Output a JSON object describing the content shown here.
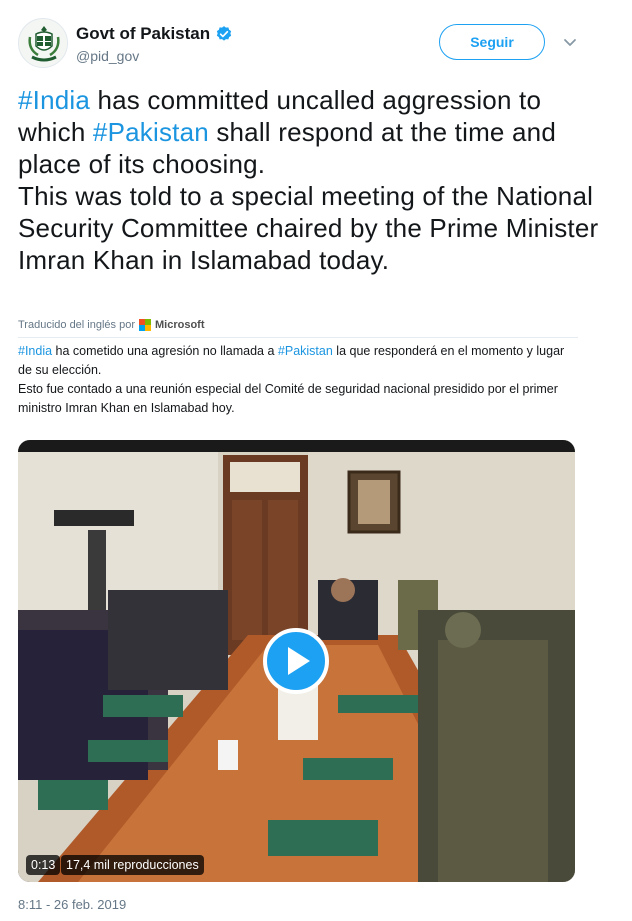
{
  "account": {
    "display_name": "Govt of Pakistan",
    "handle": "@pid_gov",
    "verified": true,
    "avatar_icon": "state-emblem-icon"
  },
  "actions": {
    "follow_label": "Seguir",
    "more_icon": "chevron-down-icon"
  },
  "tweet": {
    "line1_tag1": "#India",
    "line1_text": " has committed uncalled aggression to which ",
    "line1_tag2": "#Pakistan",
    "line1_rest": " shall respond at the time and place of its choosing.",
    "paragraph2": "This was told to a special meeting of the National Security Committee chaired by the Prime Minister Imran Khan in Islamabad today."
  },
  "translation": {
    "label": "Traducido del inglés por",
    "provider": "Microsoft",
    "tag1": "#India",
    "text1": " ha cometido una agresión no llamada a ",
    "tag2": "#Pakistan",
    "text2": " la que responderá en el momento y lugar de su elección.",
    "paragraph2": "Esto fue contado a una reunión especial del Comité de seguridad nacional presidido por el primer ministro Imran Khan en Islamabad hoy."
  },
  "video": {
    "duration": "0:13",
    "views": "17,4 mil reproducciones"
  },
  "timestamp": "8:11 - 26 feb. 2019",
  "colors": {
    "link": "#1b95e0",
    "accent": "#1da1f2",
    "secondary_text": "#657786"
  }
}
